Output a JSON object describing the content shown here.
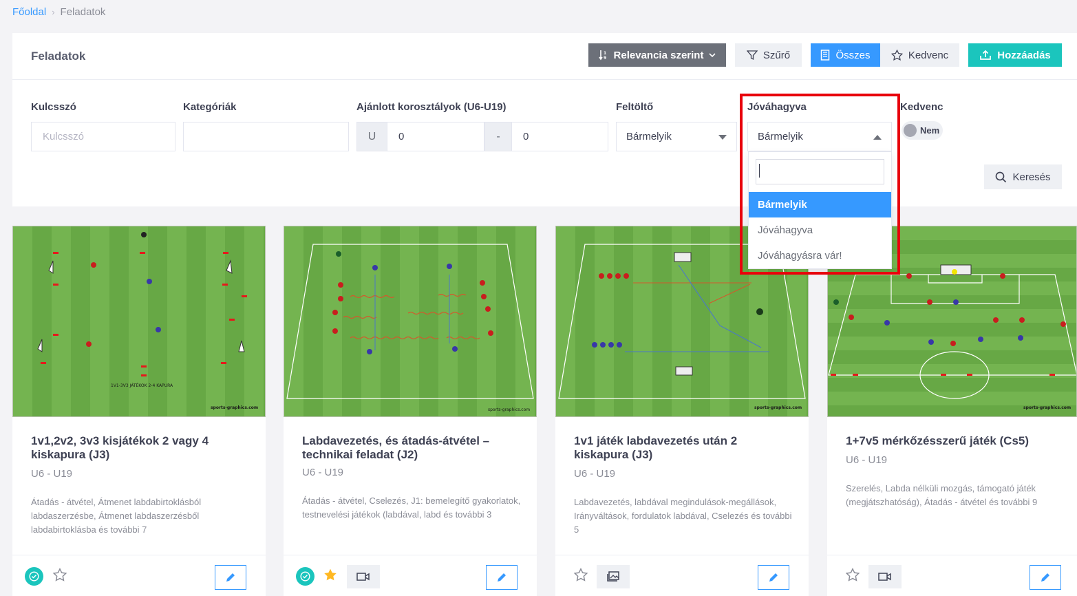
{
  "breadcrumb": {
    "home": "Főoldal",
    "current": "Feladatok"
  },
  "header": {
    "title": "Feladatok",
    "sort_label": "Relevancia szerint",
    "filter_label": "Szűrő",
    "all_label": "Összes",
    "favorite_label": "Kedvenc",
    "add_label": "Hozzáadás"
  },
  "filters": {
    "keyword_label": "Kulcsszó",
    "keyword_placeholder": "Kulcsszó",
    "category_label": "Kategóriák",
    "age_label": "Ajánlott korosztályok (U6-U19)",
    "age_prefix": "U",
    "age_from": "0",
    "age_sep": "-",
    "age_to": "0",
    "uploader_label": "Feltöltő",
    "uploader_value": "Bármelyik",
    "approved_label": "Jóváhagyva",
    "approved_value": "Bármelyik",
    "favorite_label": "Kedvenc",
    "favorite_toggle": "Nem",
    "search_button": "Keresés"
  },
  "dropdown": {
    "search_value": "",
    "options": [
      "Bármelyik",
      "Jóváhagyva",
      "Jóváhagyásra vár!"
    ],
    "selected": "Bármelyik"
  },
  "cards": [
    {
      "title": "1v1,2v2, 3v3 kisjátékok 2 vagy 4 kiskapura (J3)",
      "age": "U6 - U19",
      "description": "Átadás - átvétel, Átmenet labdabirtoklásból labdaszerzésbe, Átmenet labdaszerzésből labdabirtoklásba és további 7",
      "image_caption": "1V1-3V3 JÁTÉKOK 2-4 KAPURA",
      "watermark": "sports-graphics.com"
    },
    {
      "title": "Labdavezetés, és átadás-átvétel – technikai feladat (J2)",
      "age": "U6 - U19",
      "description": "Átadás - átvétel, Cselezés, J1: bemelegítő gyakorlatok, testnevelési játékok (labdával, labd és további 3",
      "watermark": "sports-graphics.com"
    },
    {
      "title": "1v1 játék labdavezetés után 2 kiskapura (J3)",
      "age": "U6 - U19",
      "description": "Labdavezetés, labdával megindulások-megállások, Irányváltások, fordulatok labdával, Cselezés és további 5",
      "watermark": "sports-graphics.com"
    },
    {
      "title": "1+7v5 mérkőzésszerű játék (Cs5)",
      "age": "U6 - U19",
      "description": "Szerelés, Labda nélküli mozgás, támogató játék (megjátszhatóság), Átadás - átvétel és további 9",
      "watermark": "sports-graphics.com"
    }
  ],
  "colors": {
    "primary": "#3699ff",
    "success": "#1bc5bd",
    "favorite": "#ffb822",
    "highlight": "#e8000b",
    "pitch": "#6fae4c"
  }
}
